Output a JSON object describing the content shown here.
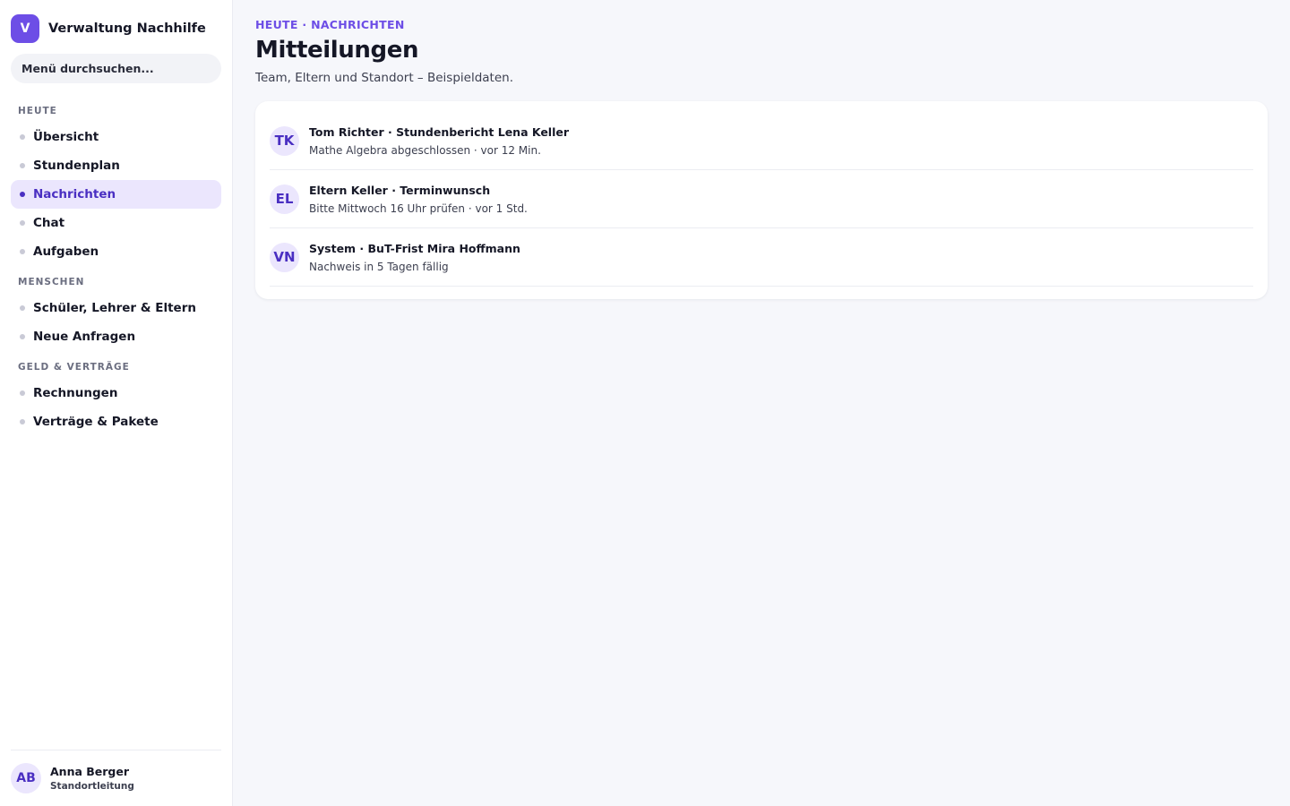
{
  "brand": {
    "logo_letter": "V",
    "name": "Verwaltung Nachhilfe"
  },
  "search": {
    "placeholder": "Menü durchsuchen..."
  },
  "sidebar": {
    "sections": [
      {
        "label": "HEUTE",
        "items": [
          "Übersicht",
          "Stundenplan",
          "Nachrichten",
          "Chat",
          "Aufgaben"
        ]
      },
      {
        "label": "MENSCHEN",
        "items": [
          "Schüler, Lehrer & Eltern",
          "Neue Anfragen"
        ]
      },
      {
        "label": "GELD & VERTRÄGE",
        "items": [
          "Rechnungen",
          "Verträge & Pakete"
        ]
      }
    ],
    "active_item": "Nachrichten"
  },
  "user": {
    "initials": "AB",
    "name": "Anna Berger",
    "role": "Standortleitung"
  },
  "page": {
    "eyebrow": "HEUTE · NACHRICHTEN",
    "title": "Mitteilungen",
    "subtitle": "Team, Eltern und Standort – Beispieldaten."
  },
  "messages": [
    {
      "initials": "TK",
      "title": "Tom Richter · Stundenbericht Lena Keller",
      "meta": "Mathe Algebra abgeschlossen · vor 12 Min."
    },
    {
      "initials": "EL",
      "title": "Eltern Keller · Terminwunsch",
      "meta": "Bitte Mittwoch 16 Uhr prüfen · vor 1 Std."
    },
    {
      "initials": "VN",
      "title": "System · BuT-Frist Mira Hoffmann",
      "meta": "Nachweis in 5 Tagen fällig"
    }
  ],
  "colors": {
    "accent": "#6d4ee6",
    "active_bg": "#ebe6fd",
    "active_text": "#4a2fc2"
  }
}
